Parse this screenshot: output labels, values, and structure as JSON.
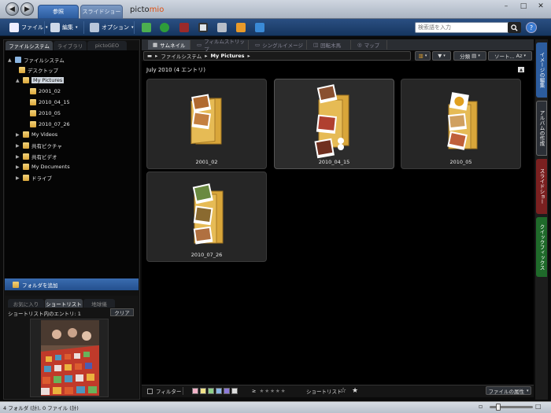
{
  "title_bar": {
    "tabs": [
      {
        "label": "参照",
        "active": true
      },
      {
        "label": "スライドショー",
        "active": false
      }
    ],
    "brand_prefix": "picto",
    "brand_suffix": "mio"
  },
  "toolbar": {
    "file_label": "ファイル",
    "edit_label": "編集",
    "options_label": "オプション",
    "search_placeholder": "検索語を入力",
    "help_label": "?"
  },
  "left_panel": {
    "tabs": [
      "ファイルシステム",
      "ライブラリ",
      "pictoGEO"
    ],
    "tree": [
      {
        "label": "ファイルシステム",
        "level": 0,
        "expanded": true
      },
      {
        "label": "デスクトップ",
        "level": 1
      },
      {
        "label": "My Pictures",
        "level": 1,
        "expanded": true,
        "selected": true
      },
      {
        "label": "2001_02",
        "level": 2
      },
      {
        "label": "2010_04_15",
        "level": 2
      },
      {
        "label": "2010_05",
        "level": 2
      },
      {
        "label": "2010_07_26",
        "level": 2
      },
      {
        "label": "My Videos",
        "level": 1,
        "collapsed": true
      },
      {
        "label": "共有ピクチャ",
        "level": 1,
        "collapsed": true
      },
      {
        "label": "共有ビデオ",
        "level": 1,
        "collapsed": true
      },
      {
        "label": "My Documents",
        "level": 1,
        "collapsed": true
      },
      {
        "label": "ドライブ",
        "level": 1,
        "collapsed": true
      }
    ],
    "add_folder_label": "フォルダを追加",
    "shortlist_tabs": [
      "お気に入り",
      "ショートリスト",
      "地球儀"
    ],
    "shortlist_count": "ショートリスト内のエントリ: 1",
    "clear_label": "クリア"
  },
  "main": {
    "view_tabs": [
      "サムネイル",
      "フィルムストリップ",
      "シングルイメージ",
      "回転木馬",
      "マップ"
    ],
    "breadcrumb": [
      "ファイルシステム",
      "My Pictures"
    ],
    "group_label": "分類",
    "sort_label": "ソート...",
    "sort_icon_label": "Az",
    "group_header": "July 2010 (4 エントリ)",
    "folders": [
      "2001_02",
      "2010_04_15",
      "2010_05",
      "2010_07_26"
    ]
  },
  "bottom_bar": {
    "filter_label": "フィルター",
    "ge_label": "≥",
    "shortlist_label": "ショートリスト",
    "properties_label": "ファイルの属性"
  },
  "right_sidebar": {
    "tabs": [
      "イメージの編集",
      "アルバムの作成",
      "スライドショー",
      "クイックフィックス"
    ]
  },
  "status_bar": {
    "text": "4 フォルダ (計), 0 ファイル (計)"
  },
  "colors": {
    "accent_blue": "#2c5c9e",
    "folder_gold": "#d9a63a",
    "tab_red": "#7a2020",
    "tab_green": "#1f6a2a",
    "label_tag_colors": [
      "#f3b3c8",
      "#f0e28a",
      "#8ed08a",
      "#8ab6e6",
      "#8c7ad8",
      "#dddddd"
    ]
  },
  "icons": {
    "back": "back-arrow-icon",
    "forward": "forward-arrow-icon",
    "file": "document-icon",
    "edit": "pencil-icon",
    "options": "options-icon",
    "search": "search-icon"
  }
}
